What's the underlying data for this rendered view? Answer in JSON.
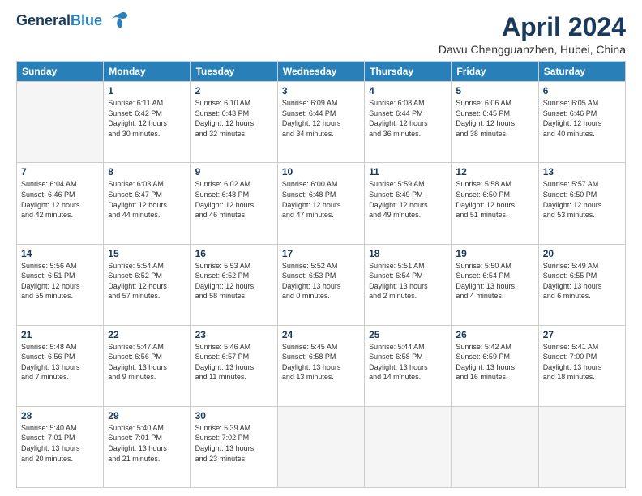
{
  "logo": {
    "line1": "General",
    "line2": "Blue"
  },
  "title": "April 2024",
  "subtitle": "Dawu Chengguanzhen, Hubei, China",
  "days_header": [
    "Sunday",
    "Monday",
    "Tuesday",
    "Wednesday",
    "Thursday",
    "Friday",
    "Saturday"
  ],
  "weeks": [
    [
      {
        "day": "",
        "info": ""
      },
      {
        "day": "1",
        "info": "Sunrise: 6:11 AM\nSunset: 6:42 PM\nDaylight: 12 hours\nand 30 minutes."
      },
      {
        "day": "2",
        "info": "Sunrise: 6:10 AM\nSunset: 6:43 PM\nDaylight: 12 hours\nand 32 minutes."
      },
      {
        "day": "3",
        "info": "Sunrise: 6:09 AM\nSunset: 6:44 PM\nDaylight: 12 hours\nand 34 minutes."
      },
      {
        "day": "4",
        "info": "Sunrise: 6:08 AM\nSunset: 6:44 PM\nDaylight: 12 hours\nand 36 minutes."
      },
      {
        "day": "5",
        "info": "Sunrise: 6:06 AM\nSunset: 6:45 PM\nDaylight: 12 hours\nand 38 minutes."
      },
      {
        "day": "6",
        "info": "Sunrise: 6:05 AM\nSunset: 6:46 PM\nDaylight: 12 hours\nand 40 minutes."
      }
    ],
    [
      {
        "day": "7",
        "info": "Sunrise: 6:04 AM\nSunset: 6:46 PM\nDaylight: 12 hours\nand 42 minutes."
      },
      {
        "day": "8",
        "info": "Sunrise: 6:03 AM\nSunset: 6:47 PM\nDaylight: 12 hours\nand 44 minutes."
      },
      {
        "day": "9",
        "info": "Sunrise: 6:02 AM\nSunset: 6:48 PM\nDaylight: 12 hours\nand 46 minutes."
      },
      {
        "day": "10",
        "info": "Sunrise: 6:00 AM\nSunset: 6:48 PM\nDaylight: 12 hours\nand 47 minutes."
      },
      {
        "day": "11",
        "info": "Sunrise: 5:59 AM\nSunset: 6:49 PM\nDaylight: 12 hours\nand 49 minutes."
      },
      {
        "day": "12",
        "info": "Sunrise: 5:58 AM\nSunset: 6:50 PM\nDaylight: 12 hours\nand 51 minutes."
      },
      {
        "day": "13",
        "info": "Sunrise: 5:57 AM\nSunset: 6:50 PM\nDaylight: 12 hours\nand 53 minutes."
      }
    ],
    [
      {
        "day": "14",
        "info": "Sunrise: 5:56 AM\nSunset: 6:51 PM\nDaylight: 12 hours\nand 55 minutes."
      },
      {
        "day": "15",
        "info": "Sunrise: 5:54 AM\nSunset: 6:52 PM\nDaylight: 12 hours\nand 57 minutes."
      },
      {
        "day": "16",
        "info": "Sunrise: 5:53 AM\nSunset: 6:52 PM\nDaylight: 12 hours\nand 58 minutes."
      },
      {
        "day": "17",
        "info": "Sunrise: 5:52 AM\nSunset: 6:53 PM\nDaylight: 13 hours\nand 0 minutes."
      },
      {
        "day": "18",
        "info": "Sunrise: 5:51 AM\nSunset: 6:54 PM\nDaylight: 13 hours\nand 2 minutes."
      },
      {
        "day": "19",
        "info": "Sunrise: 5:50 AM\nSunset: 6:54 PM\nDaylight: 13 hours\nand 4 minutes."
      },
      {
        "day": "20",
        "info": "Sunrise: 5:49 AM\nSunset: 6:55 PM\nDaylight: 13 hours\nand 6 minutes."
      }
    ],
    [
      {
        "day": "21",
        "info": "Sunrise: 5:48 AM\nSunset: 6:56 PM\nDaylight: 13 hours\nand 7 minutes."
      },
      {
        "day": "22",
        "info": "Sunrise: 5:47 AM\nSunset: 6:56 PM\nDaylight: 13 hours\nand 9 minutes."
      },
      {
        "day": "23",
        "info": "Sunrise: 5:46 AM\nSunset: 6:57 PM\nDaylight: 13 hours\nand 11 minutes."
      },
      {
        "day": "24",
        "info": "Sunrise: 5:45 AM\nSunset: 6:58 PM\nDaylight: 13 hours\nand 13 minutes."
      },
      {
        "day": "25",
        "info": "Sunrise: 5:44 AM\nSunset: 6:58 PM\nDaylight: 13 hours\nand 14 minutes."
      },
      {
        "day": "26",
        "info": "Sunrise: 5:42 AM\nSunset: 6:59 PM\nDaylight: 13 hours\nand 16 minutes."
      },
      {
        "day": "27",
        "info": "Sunrise: 5:41 AM\nSunset: 7:00 PM\nDaylight: 13 hours\nand 18 minutes."
      }
    ],
    [
      {
        "day": "28",
        "info": "Sunrise: 5:40 AM\nSunset: 7:01 PM\nDaylight: 13 hours\nand 20 minutes."
      },
      {
        "day": "29",
        "info": "Sunrise: 5:40 AM\nSunset: 7:01 PM\nDaylight: 13 hours\nand 21 minutes."
      },
      {
        "day": "30",
        "info": "Sunrise: 5:39 AM\nSunset: 7:02 PM\nDaylight: 13 hours\nand 23 minutes."
      },
      {
        "day": "",
        "info": ""
      },
      {
        "day": "",
        "info": ""
      },
      {
        "day": "",
        "info": ""
      },
      {
        "day": "",
        "info": ""
      }
    ]
  ]
}
